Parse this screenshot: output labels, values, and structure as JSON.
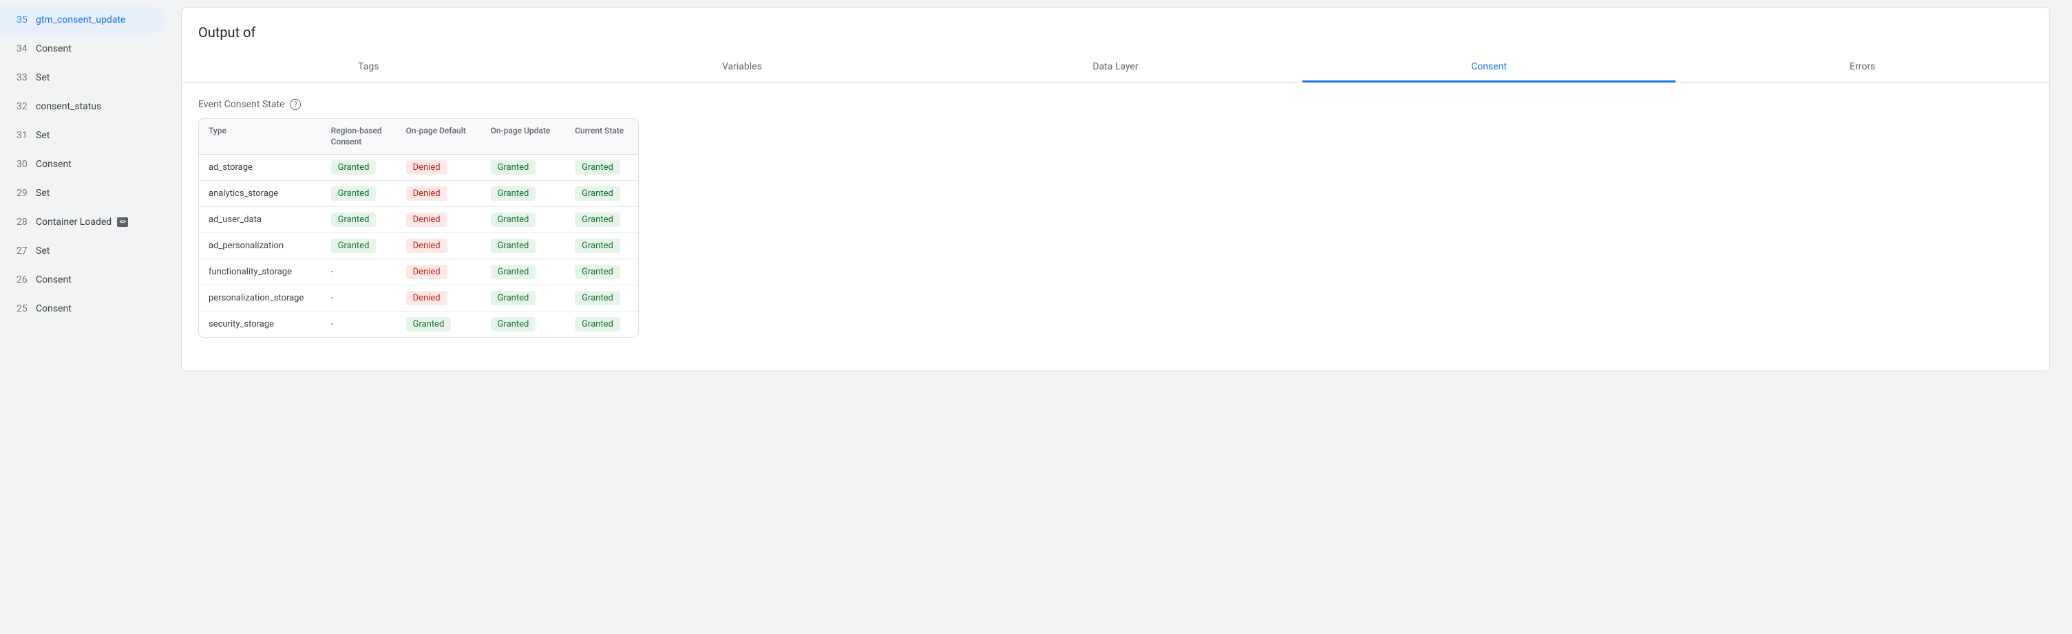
{
  "sidebar": {
    "items": [
      {
        "num": "35",
        "label": "gtm_consent_update",
        "active": true,
        "hasCodeIcon": false
      },
      {
        "num": "34",
        "label": "Consent",
        "active": false,
        "hasCodeIcon": false
      },
      {
        "num": "33",
        "label": "Set",
        "active": false,
        "hasCodeIcon": false
      },
      {
        "num": "32",
        "label": "consent_status",
        "active": false,
        "hasCodeIcon": false
      },
      {
        "num": "31",
        "label": "Set",
        "active": false,
        "hasCodeIcon": false
      },
      {
        "num": "30",
        "label": "Consent",
        "active": false,
        "hasCodeIcon": false
      },
      {
        "num": "29",
        "label": "Set",
        "active": false,
        "hasCodeIcon": false
      },
      {
        "num": "28",
        "label": "Container Loaded",
        "active": false,
        "hasCodeIcon": true
      },
      {
        "num": "27",
        "label": "Set",
        "active": false,
        "hasCodeIcon": false
      },
      {
        "num": "26",
        "label": "Consent",
        "active": false,
        "hasCodeIcon": false
      },
      {
        "num": "25",
        "label": "Consent",
        "active": false,
        "hasCodeIcon": false
      }
    ]
  },
  "panel": {
    "title": "Output of"
  },
  "tabs": [
    {
      "label": "Tags",
      "active": false
    },
    {
      "label": "Variables",
      "active": false
    },
    {
      "label": "Data Layer",
      "active": false
    },
    {
      "label": "Consent",
      "active": true
    },
    {
      "label": "Errors",
      "active": false
    }
  ],
  "section": {
    "title": "Event Consent State"
  },
  "table": {
    "headers": [
      "Type",
      "Region-based Consent",
      "On-page Default",
      "On-page Update",
      "Current State"
    ],
    "rows": [
      {
        "type": "ad_storage",
        "cells": [
          "Granted",
          "Denied",
          "Granted",
          "Granted"
        ]
      },
      {
        "type": "analytics_storage",
        "cells": [
          "Granted",
          "Denied",
          "Granted",
          "Granted"
        ]
      },
      {
        "type": "ad_user_data",
        "cells": [
          "Granted",
          "Denied",
          "Granted",
          "Granted"
        ]
      },
      {
        "type": "ad_personalization",
        "cells": [
          "Granted",
          "Denied",
          "Granted",
          "Granted"
        ]
      },
      {
        "type": "functionality_storage",
        "cells": [
          "-",
          "Denied",
          "Granted",
          "Granted"
        ]
      },
      {
        "type": "personalization_storage",
        "cells": [
          "-",
          "Denied",
          "Granted",
          "Granted"
        ]
      },
      {
        "type": "security_storage",
        "cells": [
          "-",
          "Granted",
          "Granted",
          "Granted"
        ]
      }
    ]
  }
}
